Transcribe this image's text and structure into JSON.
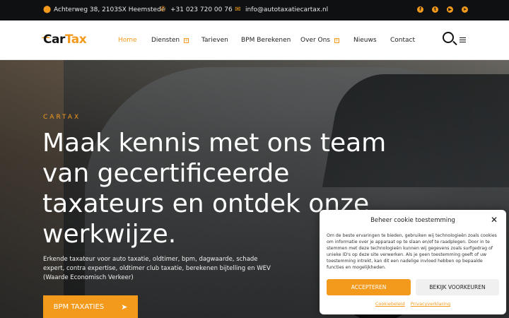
{
  "topbar": {
    "address": "Achterweg 38, 2103SX Heemstede",
    "phone": "+31 023 720 00 76",
    "email": "info@autotaxatiecartax.nl",
    "social": [
      {
        "name": "facebook-icon",
        "glyph": "f"
      },
      {
        "name": "twitter-icon",
        "glyph": "t"
      },
      {
        "name": "youtube-icon",
        "glyph": "▶"
      },
      {
        "name": "telegram-icon",
        "glyph": "➤"
      }
    ]
  },
  "brand": {
    "logo_car": "Car",
    "logo_tax": "Tax",
    "accent_color": "#f39a1d"
  },
  "nav": {
    "items": [
      {
        "label": "Home",
        "active": true
      },
      {
        "label": "Diensten",
        "has_submenu": true
      },
      {
        "label": "Tarieven"
      },
      {
        "label": "BPM Berekenen"
      },
      {
        "label": "Over Ons",
        "has_submenu": true
      },
      {
        "label": "Nieuws"
      },
      {
        "label": "Contact"
      }
    ]
  },
  "hero": {
    "eyebrow": "CARTAX",
    "headline": "Maak kennis met ons team van gecertificeerde taxateurs en ontdek onze werkwijze.",
    "lede": "Erkende taxateur voor auto taxatie, oldtimer, bpm, dagwaarde, schade expert, contra expertise, oldtimer club taxatie, berekenen bijtelling en WEV (Waarde Economisch Verkeer)",
    "cta_label": "BPM TAXATIES"
  },
  "cookie": {
    "title": "Beheer cookie toestemming",
    "body": "Om de beste ervaringen te bieden, gebruiken wij technologieën zoals cookies om informatie over je apparaat op te slaan en/of te raadplegen. Door in te stemmen met deze technologieën kunnen wij gegevens zoals surfgedrag of unieke ID's op deze site verwerken. Als je geen toestemming geeft of uw toestemming intrekt, kan dit een nadelige invloed hebben op bepaalde functies en mogelijkheden.",
    "accept_label": "ACCEPTEREN",
    "prefs_label": "BEKIJK VOORKEUREN",
    "link_cookie": "Cookiebeleid",
    "link_privacy": "Privacyverklaring"
  }
}
